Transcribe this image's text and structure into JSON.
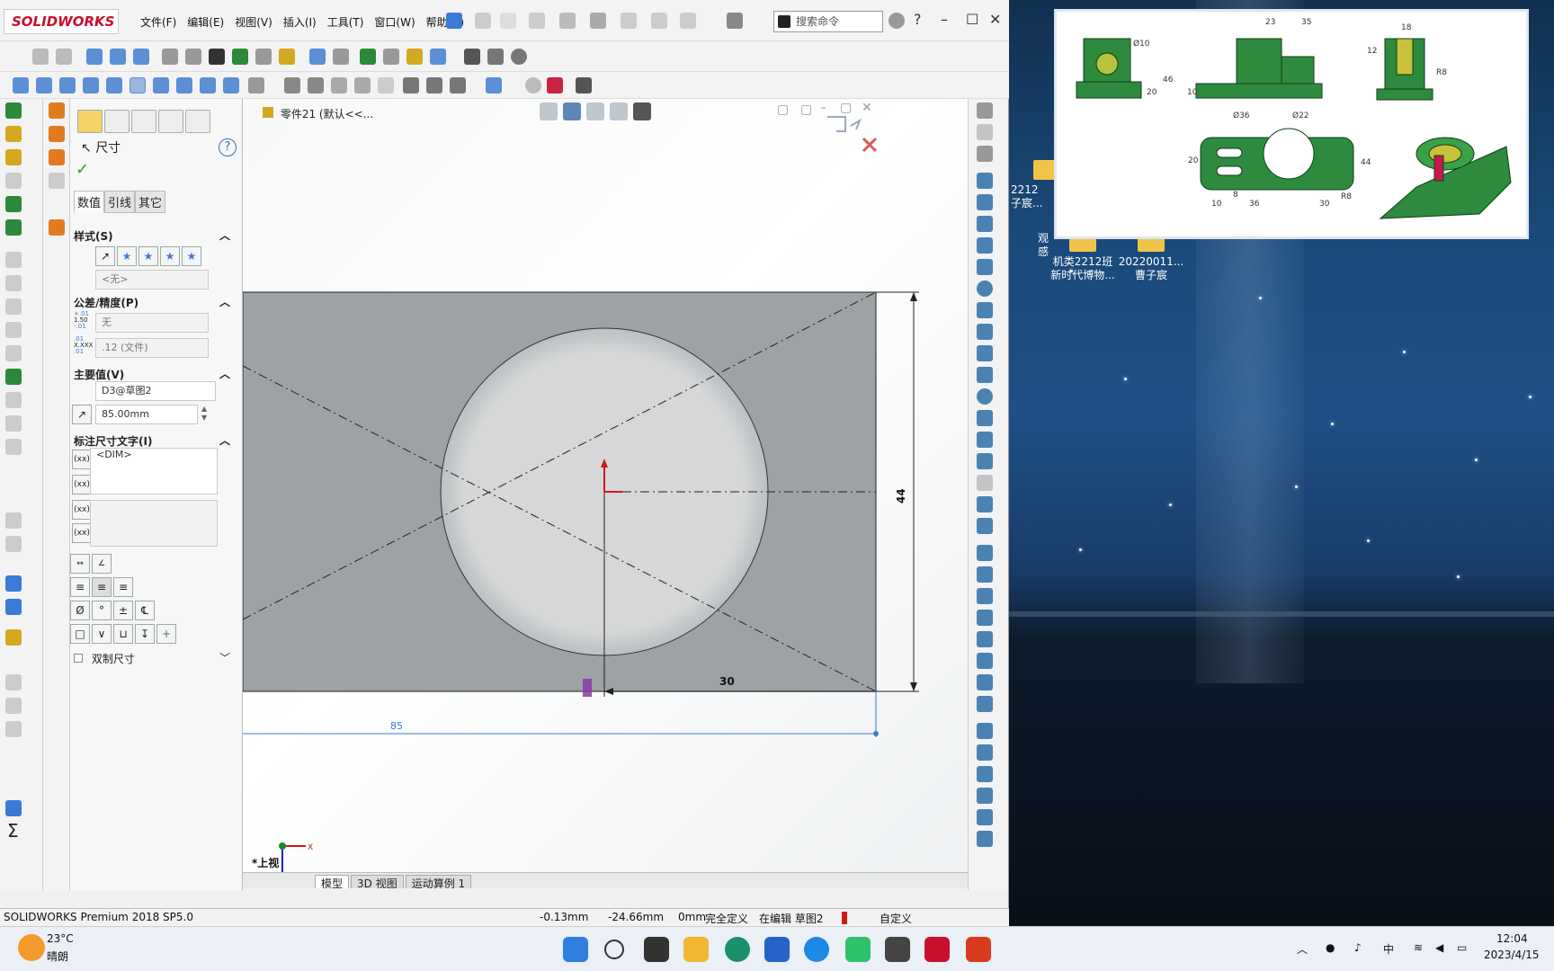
{
  "app": {
    "logo": "SOLIDWORKS"
  },
  "menu": [
    "文件(F)",
    "编辑(E)",
    "视图(V)",
    "插入(I)",
    "工具(T)",
    "窗口(W)",
    "帮助(H)"
  ],
  "search": {
    "placeholder": "搜索命令"
  },
  "property_manager": {
    "title": "尺寸",
    "tabs": [
      "数值",
      "引线",
      "其它"
    ],
    "style_section": "样式(S)",
    "style_value": "<无>",
    "tolerance_section": "公差/精度(P)",
    "tolerance_value": "无",
    "precision_value": ".12 (文件)",
    "primary_section": "主要值(V)",
    "primary_name": "D3@草图2",
    "primary_value": "85.00mm",
    "dimtext_section": "标注尺寸文字(I)",
    "dimtext_value": "<DIM>",
    "dual_label": "双制尺寸",
    "tol_top": "+.01",
    "tol_mid": "1.50",
    "tol_bot": "-.01",
    "prec_top": ".01",
    "prec_mid": "X.XXX",
    "prec_bot": ".01"
  },
  "viewport": {
    "tree_label": "零件21  (默认<<...",
    "view_label": "*上视",
    "dim_44": "44",
    "dim_30": "30",
    "dim_85": "85",
    "axis_x": "X",
    "tabs": [
      "模型",
      "3D 视图",
      "运动算例 1"
    ]
  },
  "status": {
    "product": "SOLIDWORKS Premium 2018 SP5.0",
    "x": "-0.13mm",
    "y": "-24.66mm",
    "z": "0mm",
    "state": "完全定义",
    "editing": "在编辑 草图2",
    "units": "自定义"
  },
  "desktop_icons": [
    {
      "label": "机类2212班\n新时代博物..."
    },
    {
      "label": "20220011...\n曹子宸"
    },
    {
      "label": "2212\n子宸..."
    },
    {
      "label": "观\n感"
    }
  ],
  "taskbar": {
    "temperature": "23°C",
    "weather": "晴朗",
    "time": "12:04",
    "date": "2023/4/15",
    "ime": "中"
  },
  "reference": {
    "dims": [
      "23",
      "35",
      "18",
      "12",
      "R8",
      "Ø10",
      "20",
      "10",
      "46",
      "Ø36",
      "Ø22",
      "44",
      "30",
      "10",
      "36",
      "R8",
      "20",
      "8"
    ]
  }
}
